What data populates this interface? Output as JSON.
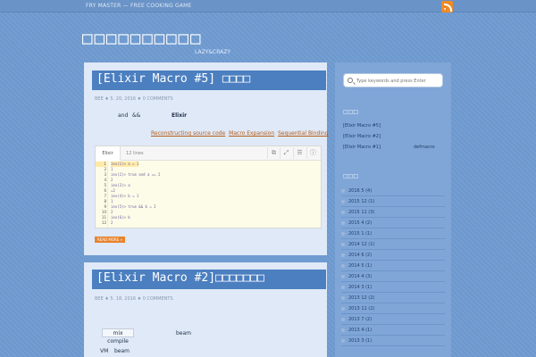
{
  "topbar": {
    "link": "FRY MASTER — FREE COOKING GAME"
  },
  "header": {
    "title": "□□□□□□□□□□",
    "description": "LAZY&CRAZY"
  },
  "posts": [
    {
      "title": "[Elixir Macro #5] □□□□",
      "meta": "BEE ♦ 5. 20, 2016 ♦ 0 COMMENTS",
      "body_fragment_1": "and",
      "body_fragment_2": "&&",
      "body_fragment_3": "Elixir",
      "links": [
        "Reconstructing source code",
        "Macro Expansion",
        "Sequential Binding"
      ],
      "code": {
        "tab": "Elixir",
        "lines_label": "12 lines",
        "lines": [
          "iex(1)> a = 1",
          "1",
          "iex(2)> true and a == 2",
          "2",
          "iex(3)> a",
          "=2",
          "iex(4)> b = 1",
          "1",
          "iex(5)> true && b = 2",
          "2",
          "iex(6)> b",
          "2"
        ]
      },
      "read_more": "READ MORE »"
    },
    {
      "title": "[Elixir Macro #2]□□□□□□□",
      "meta": "BEE ♦ 5. 18, 2016 ♦ 0 COMMENTS",
      "chip": "mix compile",
      "word_beam": "beam",
      "word_vm": "VM",
      "word_beam2": "beam"
    }
  ],
  "sidebar": {
    "search_placeholder": "Type keywords and press Enter",
    "recent_title": "□□□",
    "recent": [
      "[Elixir Macro #5]",
      "[Elixir Macro #2]",
      "[Elixir Macro #1]"
    ],
    "recent_extra": "defmacro",
    "archive_title": "□□□",
    "archive": [
      "2016 5  (4)",
      "2015 12  (1)",
      "2015 11  (3)",
      "2015 4  (2)",
      "2015 1  (1)",
      "2014 12  (1)",
      "2014 6  (2)",
      "2014 5  (1)",
      "2014 4  (3)",
      "2014 3  (1)",
      "2013 12  (2)",
      "2013 11  (2)",
      "2013 7  (2)",
      "2013 4  (1)",
      "2013 3  (1)"
    ]
  }
}
